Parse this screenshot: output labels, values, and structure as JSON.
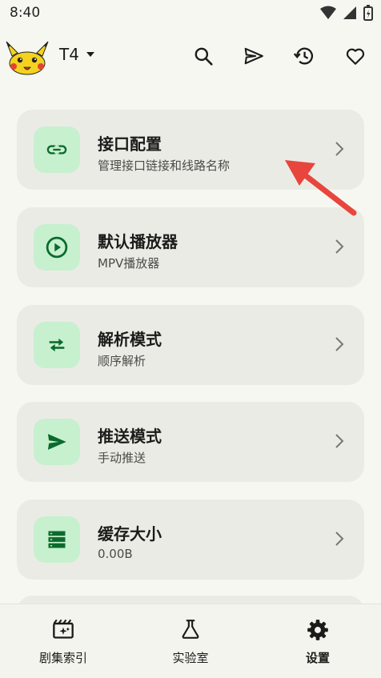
{
  "status_bar": {
    "time": "8:40"
  },
  "header": {
    "source_name": "T4"
  },
  "settings": [
    {
      "title": "接口配置",
      "subtitle": "管理接口链接和线路名称",
      "icon": "link-icon"
    },
    {
      "title": "默认播放器",
      "subtitle": "MPV播放器",
      "icon": "play-circle-icon"
    },
    {
      "title": "解析模式",
      "subtitle": "顺序解析",
      "icon": "swap-arrows-icon"
    },
    {
      "title": "推送模式",
      "subtitle": "手动推送",
      "icon": "send-icon"
    },
    {
      "title": "缓存大小",
      "subtitle": "0.00B",
      "icon": "storage-icon"
    }
  ],
  "nav": [
    {
      "label": "剧集索引",
      "icon": "movie-icon"
    },
    {
      "label": "实验室",
      "icon": "flask-icon"
    },
    {
      "label": "设置",
      "icon": "gear-icon",
      "active": true
    }
  ],
  "colors": {
    "accent": "#0b6b2c",
    "icon_bg": "#c7f0cf",
    "card_bg": "#ebebe6",
    "annotation": "#e8453c"
  }
}
